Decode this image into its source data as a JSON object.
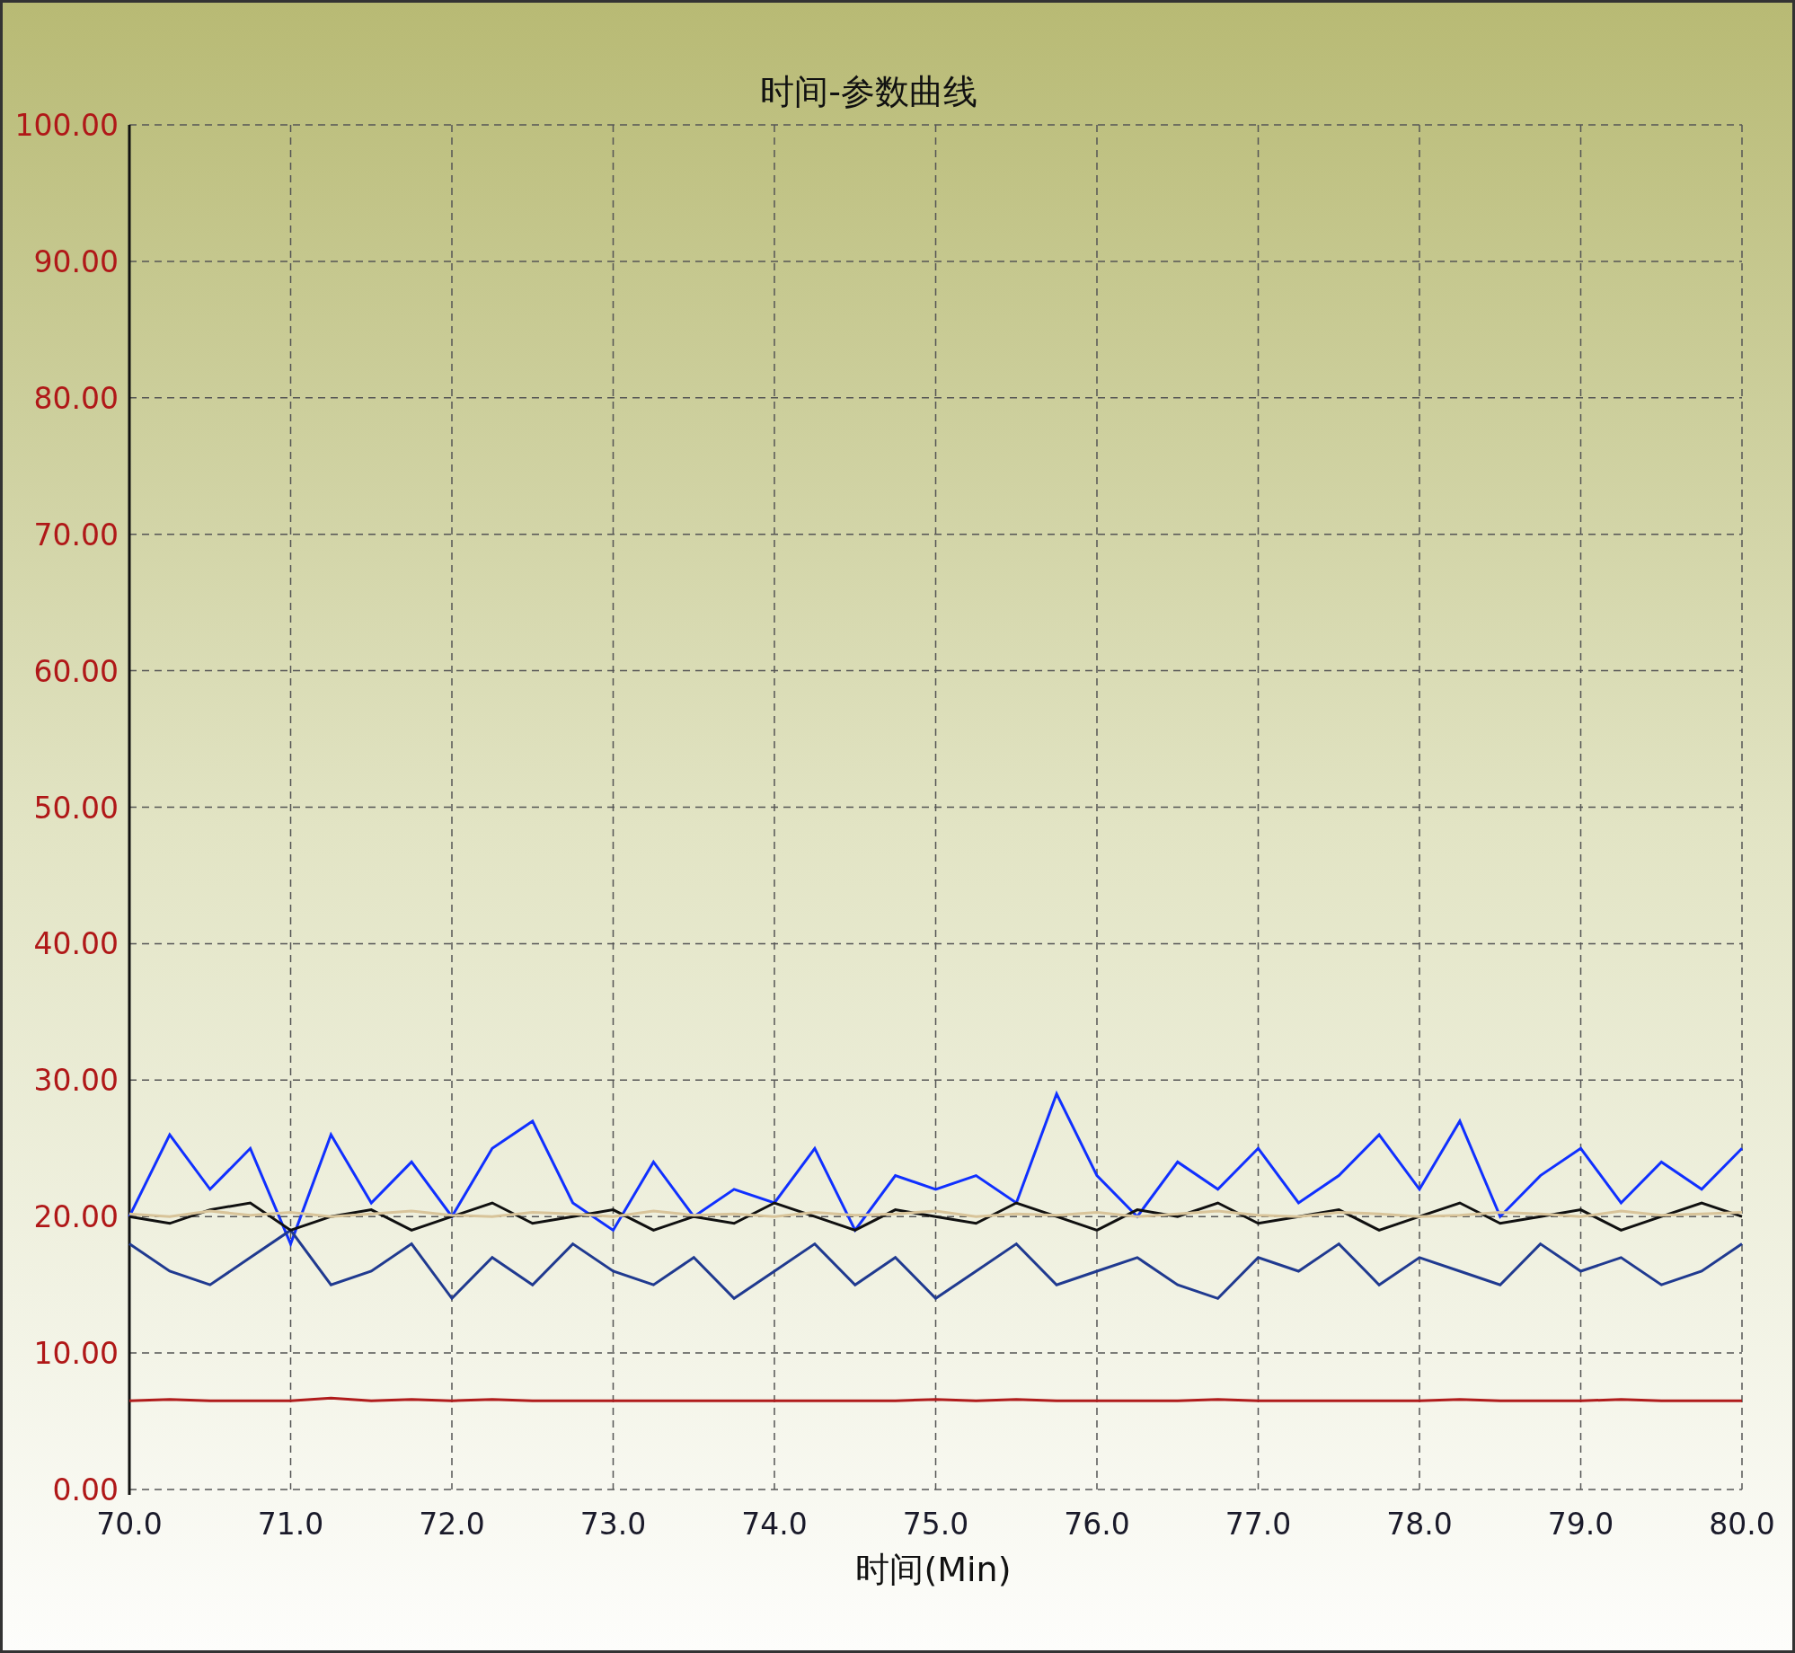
{
  "chart_data": {
    "type": "line",
    "title": "时间-参数曲线",
    "xlabel": "时间(Min)",
    "x": [
      70,
      70.25,
      70.5,
      70.75,
      71,
      71.25,
      71.5,
      71.75,
      72,
      72.25,
      72.5,
      72.75,
      73,
      73.25,
      73.5,
      73.75,
      74,
      74.25,
      74.5,
      74.75,
      75,
      75.25,
      75.5,
      75.75,
      76,
      76.25,
      76.5,
      76.75,
      77,
      77.25,
      77.5,
      77.75,
      78,
      78.25,
      78.5,
      78.75,
      79,
      79.25,
      79.5,
      79.75,
      80
    ],
    "series": [
      {
        "color": "#1030ff",
        "values": [
          20,
          26,
          22,
          25,
          18,
          26,
          21,
          24,
          20,
          25,
          27,
          21,
          19,
          24,
          20,
          22,
          21,
          25,
          19,
          23,
          22,
          23,
          21,
          29,
          23,
          20,
          24,
          22,
          25,
          21,
          23,
          26,
          22,
          27,
          20,
          23,
          25,
          21,
          24,
          22,
          25
        ]
      },
      {
        "color": "#203a90",
        "values": [
          18,
          16,
          15,
          17,
          19,
          15,
          16,
          18,
          14,
          17,
          15,
          18,
          16,
          15,
          17,
          14,
          16,
          18,
          15,
          17,
          14,
          16,
          18,
          15,
          16,
          17,
          15,
          14,
          17,
          16,
          18,
          15,
          17,
          16,
          15,
          18,
          16,
          17,
          15,
          16,
          18
        ]
      },
      {
        "color": "#101010",
        "values": [
          20,
          19.5,
          20.5,
          21,
          19,
          20,
          20.5,
          19,
          20,
          21,
          19.5,
          20,
          20.5,
          19,
          20,
          19.5,
          21,
          20,
          19,
          20.5,
          20,
          19.5,
          21,
          20,
          19,
          20.5,
          20,
          21,
          19.5,
          20,
          20.5,
          19,
          20,
          21,
          19.5,
          20,
          20.5,
          19,
          20,
          21,
          20
        ]
      },
      {
        "color": "#d8c49a",
        "values": [
          20.2,
          20,
          20.4,
          20.1,
          20.3,
          20,
          20.2,
          20.4,
          20.1,
          20,
          20.3,
          20.2,
          20,
          20.4,
          20.1,
          20.2,
          20,
          20.3,
          20.1,
          20.2,
          20.4,
          20,
          20.2,
          20.1,
          20.3,
          20,
          20.2,
          20.4,
          20.1,
          20,
          20.3,
          20.2,
          20,
          20.1,
          20.3,
          20.2,
          20,
          20.4,
          20.1,
          20.2,
          20.3
        ]
      },
      {
        "color": "#b01c1c",
        "values": [
          6.5,
          6.6,
          6.5,
          6.5,
          6.5,
          6.7,
          6.5,
          6.6,
          6.5,
          6.6,
          6.5,
          6.5,
          6.5,
          6.5,
          6.5,
          6.5,
          6.5,
          6.5,
          6.5,
          6.5,
          6.6,
          6.5,
          6.6,
          6.5,
          6.5,
          6.5,
          6.5,
          6.6,
          6.5,
          6.5,
          6.5,
          6.5,
          6.5,
          6.6,
          6.5,
          6.5,
          6.5,
          6.6,
          6.5,
          6.5,
          6.5
        ]
      }
    ],
    "grid": true,
    "xlim": [
      70,
      80
    ],
    "ylim": [
      0,
      100
    ],
    "xticks": [
      {
        "value": 70,
        "label": "70.0"
      },
      {
        "value": 71,
        "label": "71.0"
      },
      {
        "value": 72,
        "label": "72.0"
      },
      {
        "value": 73,
        "label": "73.0"
      },
      {
        "value": 74,
        "label": "74.0"
      },
      {
        "value": 75,
        "label": "75.0"
      },
      {
        "value": 76,
        "label": "76.0"
      },
      {
        "value": 77,
        "label": "77.0"
      },
      {
        "value": 78,
        "label": "78.0"
      },
      {
        "value": 79,
        "label": "79.0"
      },
      {
        "value": 80,
        "label": "80.0"
      }
    ],
    "yticks": [
      {
        "value": 0,
        "label": "0.00"
      },
      {
        "value": 10,
        "label": "10.00"
      },
      {
        "value": 20,
        "label": "20.00"
      },
      {
        "value": 30,
        "label": "30.00"
      },
      {
        "value": 40,
        "label": "40.00"
      },
      {
        "value": 50,
        "label": "50.00"
      },
      {
        "value": 60,
        "label": "60.00"
      },
      {
        "value": 70,
        "label": "70.00"
      },
      {
        "value": 80,
        "label": "80.00"
      },
      {
        "value": 90,
        "label": "90.00"
      },
      {
        "value": 100,
        "label": "100.00"
      }
    ]
  }
}
